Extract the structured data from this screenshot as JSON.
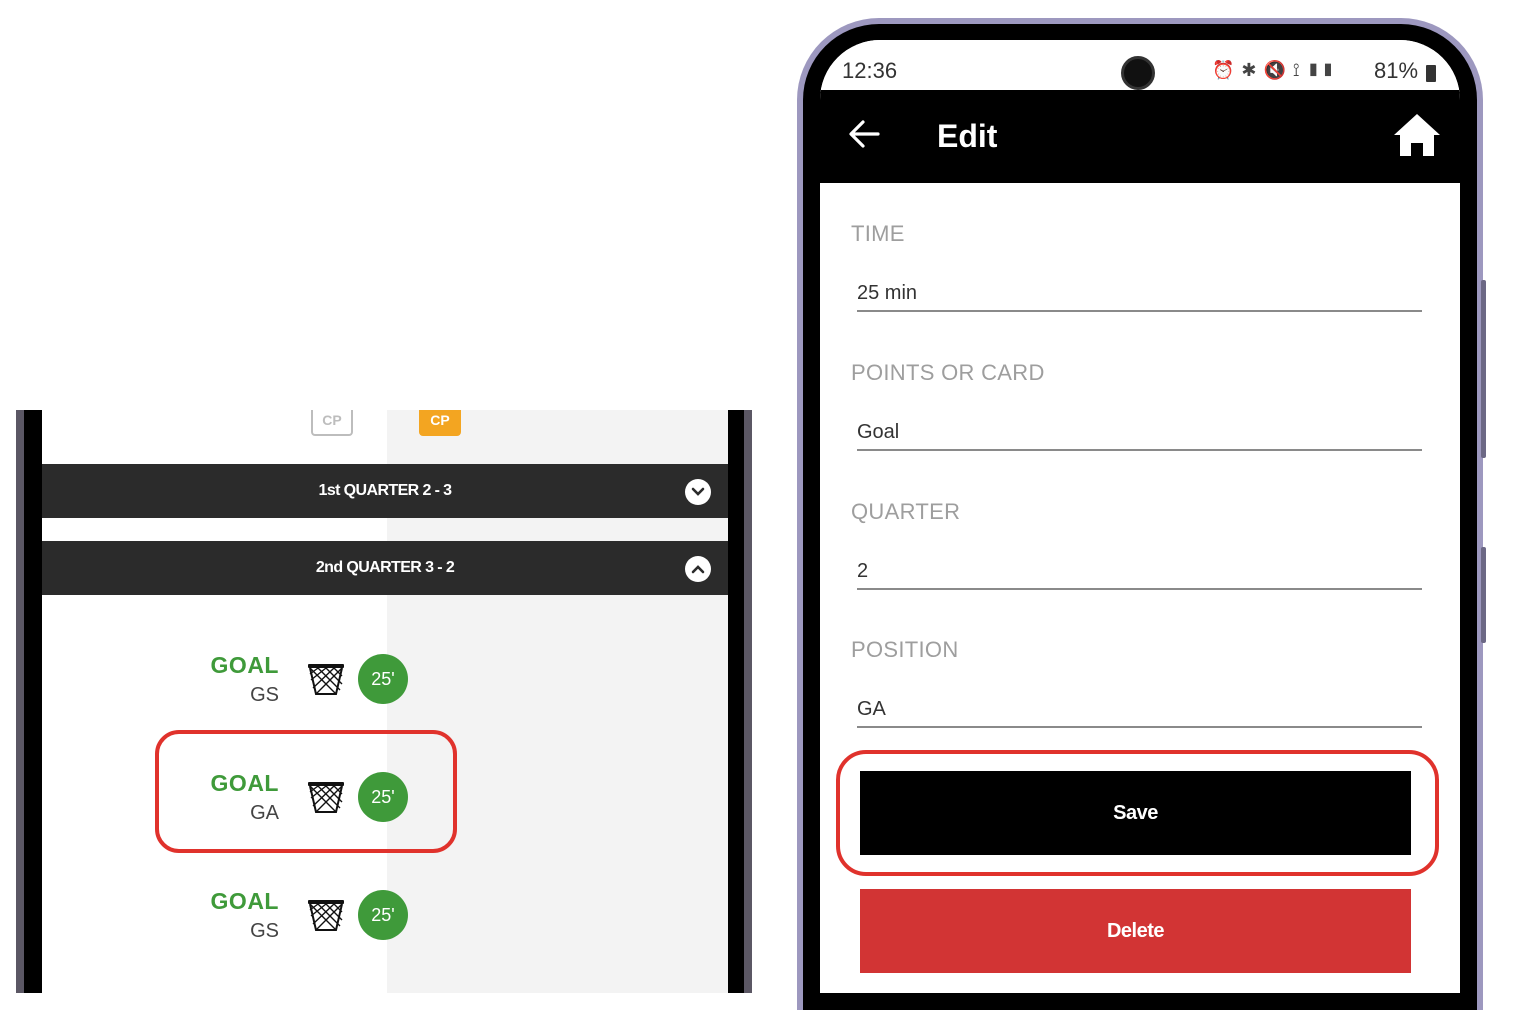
{
  "left": {
    "cp_tags": [
      "CP",
      "CP"
    ],
    "quarters": [
      {
        "label": "1st QUARTER 2 - 3",
        "expanded": false
      },
      {
        "label": "2nd QUARTER 3 - 2",
        "expanded": true
      }
    ],
    "events": [
      {
        "label": "GOAL",
        "position": "GS",
        "minute": "25'"
      },
      {
        "label": "GOAL",
        "position": "GA",
        "minute": "25'"
      },
      {
        "label": "GOAL",
        "position": "GS",
        "minute": "25'"
      }
    ]
  },
  "right": {
    "status": {
      "time": "12:36",
      "battery": "81%"
    },
    "app_bar": {
      "title": "Edit"
    },
    "fields": [
      {
        "label": "TIME",
        "value": "25 min"
      },
      {
        "label": "POINTS OR CARD",
        "value": "Goal"
      },
      {
        "label": "QUARTER",
        "value": "2"
      },
      {
        "label": "POSITION",
        "value": "GA"
      }
    ],
    "buttons": {
      "save": "Save",
      "delete": "Delete"
    }
  },
  "colors": {
    "goal_green": "#3f9a3a",
    "delete_red": "#d23434",
    "highlight_red": "#e0322c",
    "cp_orange": "#f3a521",
    "phone_frame": "#9d98bf"
  },
  "icons": [
    "chevron-down-icon",
    "chevron-up-icon",
    "netball-hoop-icon",
    "back-arrow-icon",
    "home-icon",
    "camera-icon",
    "battery-icon"
  ]
}
